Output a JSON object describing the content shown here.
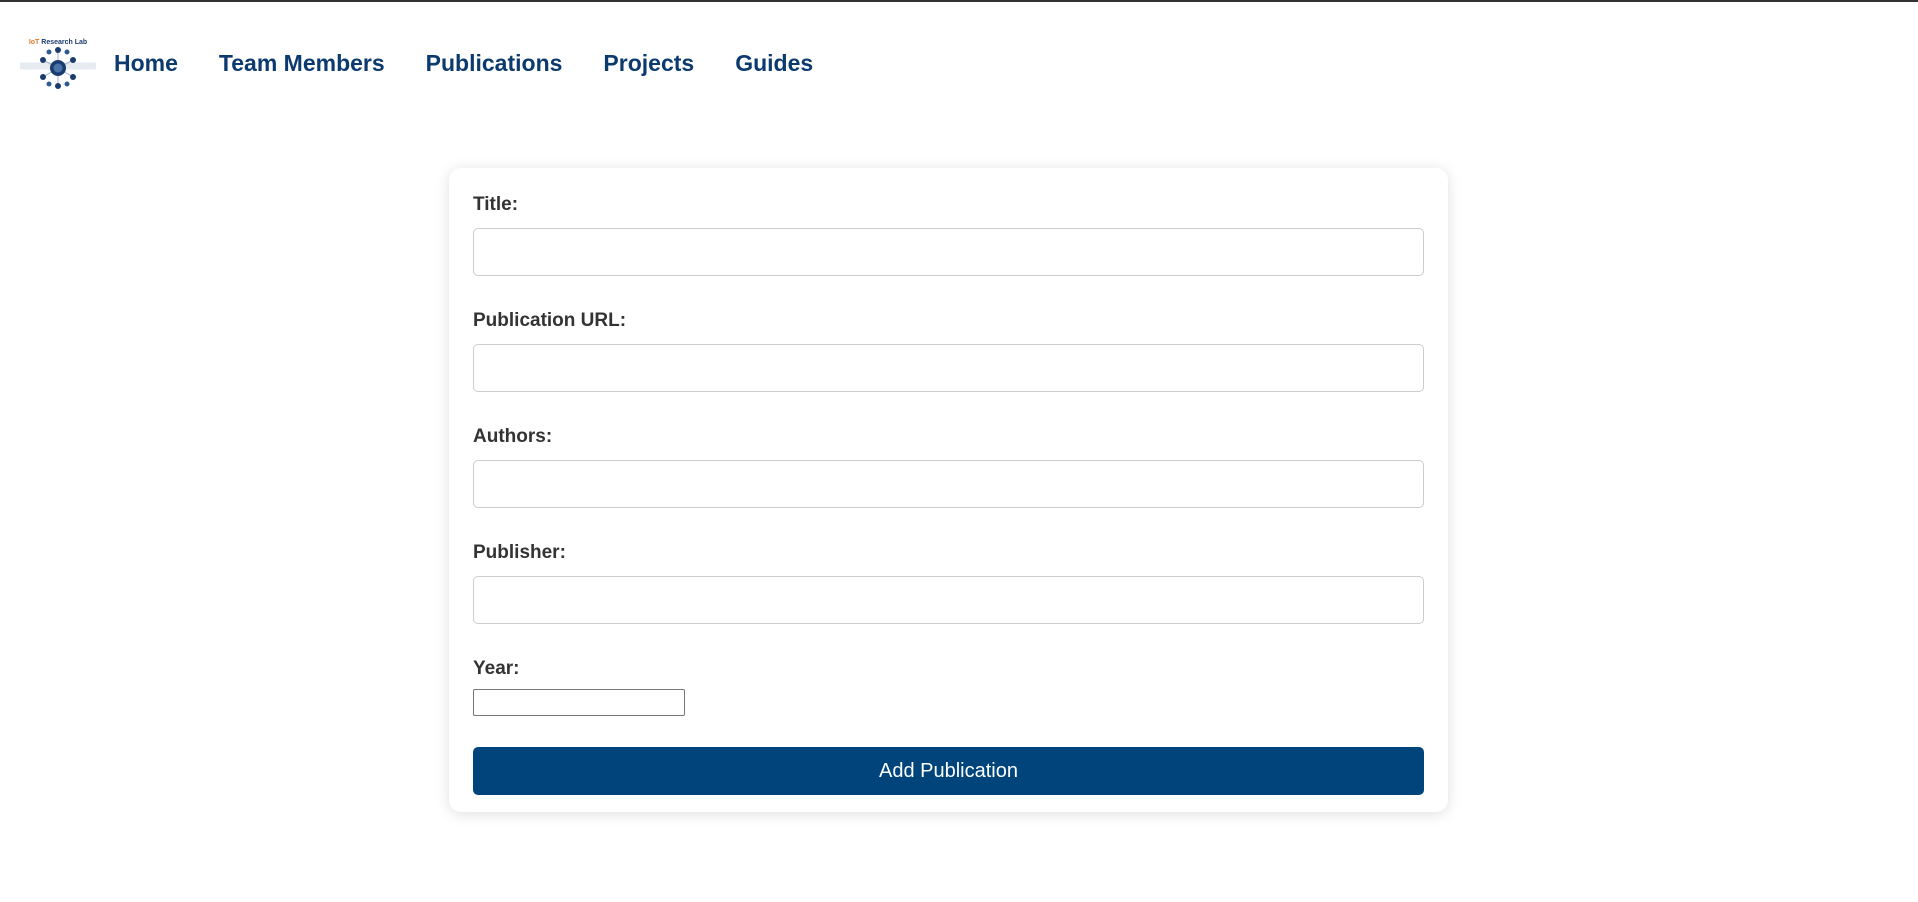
{
  "header": {
    "logo": {
      "caption_accent": "IoT",
      "caption_text": " Research Lab",
      "icon": "lab-network-logo-icon"
    },
    "nav": [
      {
        "label": "Home"
      },
      {
        "label": "Team Members"
      },
      {
        "label": "Publications"
      },
      {
        "label": "Projects"
      },
      {
        "label": "Guides"
      }
    ]
  },
  "form": {
    "fields": {
      "title": {
        "label": "Title:",
        "value": ""
      },
      "url": {
        "label": "Publication URL:",
        "value": ""
      },
      "authors": {
        "label": "Authors:",
        "value": ""
      },
      "publisher": {
        "label": "Publisher:",
        "value": ""
      },
      "year": {
        "label": "Year:",
        "value": ""
      }
    },
    "submit_label": "Add Publication"
  },
  "colors": {
    "nav_text": "#0b3a6e",
    "button_bg": "#00447c",
    "label_text": "#333333"
  }
}
